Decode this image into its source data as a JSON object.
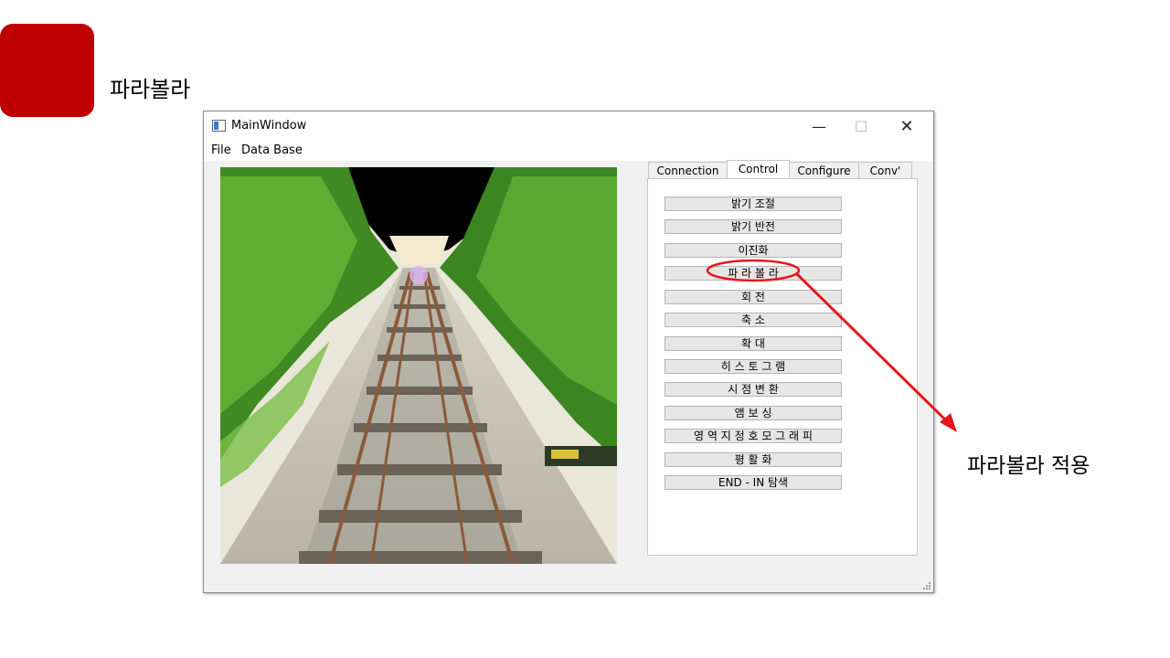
{
  "slide": {
    "title": "파라볼라",
    "callout": "파라볼라 적용",
    "accent_color": "#c00000",
    "annotation_color": "#e8161a"
  },
  "window": {
    "title": "MainWindow",
    "controls": {
      "minimize": "—",
      "maximize": "☐",
      "close": "✕"
    },
    "icon": "app-window-icon"
  },
  "menu": {
    "items": [
      "File",
      "Data Base"
    ]
  },
  "tabs": {
    "items": [
      "Connection",
      "Control",
      "Configure",
      "Conv'"
    ],
    "active": "Control"
  },
  "control_buttons": [
    "밝기 조절",
    "밝기 반전",
    "이진화",
    "파 라 볼 라",
    "회 전",
    "축 소",
    "확 대",
    "히 스 토 그 램",
    "시 점 변 환",
    "앰 보 싱",
    "영 역 지 정 호 모 그 래 피",
    "평 활 화",
    "END - IN 탐색"
  ],
  "image": {
    "subject": "railway-track-parabola-processed",
    "colors": {
      "sky": "#000000",
      "foliage": "#4f9a2c",
      "gravel": "#a9b6c8",
      "rail": "#8a5a3a"
    }
  }
}
